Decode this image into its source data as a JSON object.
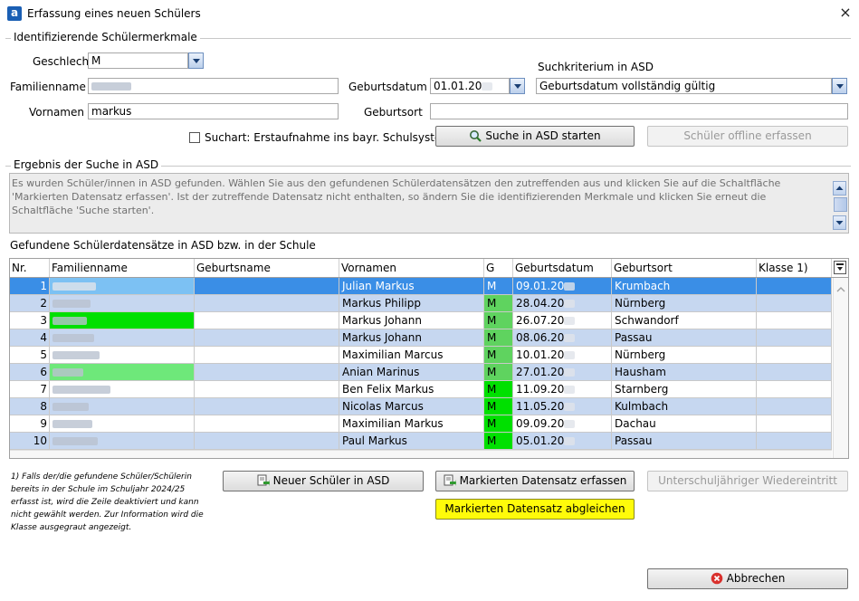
{
  "window": {
    "title": "Erfassung eines neuen Schülers",
    "close_label": "×",
    "app_icon_letter": "a"
  },
  "group1": {
    "label": "Identifizierende Schülermerkmale"
  },
  "form": {
    "geschlecht_label": "Geschlecht",
    "geschlecht_value": "M",
    "familienname_label": "Familienname",
    "familienname_value": "",
    "vornamen_label": "Vornamen",
    "vornamen_value": "markus",
    "geburtsdatum_label": "Geburtsdatum",
    "geburtsdatum_value": "01.01.20",
    "geburtsort_label": "Geburtsort",
    "geburtsort_value": "",
    "suchkriterium_label": "Suchkriterium in ASD",
    "suchkriterium_value": "Geburtsdatum vollständig gültig",
    "suchart_label": "Suchart: Erstaufnahme ins bayr. Schulsystem",
    "suchart_checked": false
  },
  "buttons": {
    "search": "Suche in ASD starten",
    "offline": "Schüler offline erfassen",
    "new_student": "Neuer Schüler in ASD",
    "capture_marked": "Markierten Datensatz erfassen",
    "reentry": "Unterschuljähriger Wiedereintritt",
    "compare_marked": "Markierten Datensatz abgleichen",
    "cancel": "Abbrechen"
  },
  "group2": {
    "label": "Ergebnis der Suche in ASD"
  },
  "info_text": "Es wurden Schüler/innen in ASD gefunden. Wählen Sie aus den gefundenen Schülerdatensätzen den zutreffenden aus und klicken Sie auf die Schaltfläche 'Markierten Datensatz erfassen'. Ist der zutreffende Datensatz nicht enthalten, so ändern Sie die identifizierenden Merkmale und klicken Sie erneut die Schaltfläche 'Suche starten'.",
  "grid_title": "Gefundene Schülerdatensätze in ASD bzw. in der Schule",
  "columns": [
    "Nr.",
    "Familienname",
    "Geburtsname",
    "Vornamen",
    "G",
    "Geburtsdatum",
    "Geburtsort",
    "Klasse 1)"
  ],
  "rows": [
    {
      "nr": "1",
      "vornamen": "Julian Markus",
      "g": "M",
      "geburtsdatum": "09.01.20",
      "geburtsort": "Krumbach",
      "selected": true
    },
    {
      "nr": "2",
      "vornamen": "Markus Philipp",
      "g": "M",
      "geburtsdatum": "28.04.20",
      "geburtsort": "Nürnberg"
    },
    {
      "nr": "3",
      "vornamen": "Markus Johann",
      "g": "M",
      "geburtsdatum": "26.07.20",
      "geburtsort": "Schwandorf"
    },
    {
      "nr": "4",
      "vornamen": "Markus Johann",
      "g": "M",
      "geburtsdatum": "08.06.20",
      "geburtsort": "Passau"
    },
    {
      "nr": "5",
      "vornamen": "Maximilian Marcus",
      "g": "M",
      "geburtsdatum": "10.01.20",
      "geburtsort": "Nürnberg"
    },
    {
      "nr": "6",
      "vornamen": "Anian Marinus",
      "g": "M",
      "geburtsdatum": "27.01.20",
      "geburtsort": "Hausham"
    },
    {
      "nr": "7",
      "vornamen": "Ben Felix Markus",
      "g": "M",
      "geburtsdatum": "11.09.20",
      "geburtsort": "Starnberg"
    },
    {
      "nr": "8",
      "vornamen": "Nicolas Marcus",
      "g": "M",
      "geburtsdatum": "11.05.20",
      "geburtsort": "Kulmbach"
    },
    {
      "nr": "9",
      "vornamen": "Maximilian Markus",
      "g": "M",
      "geburtsdatum": "09.09.20",
      "geburtsort": "Dachau"
    },
    {
      "nr": "10",
      "vornamen": "Paul Markus",
      "g": "M",
      "geburtsdatum": "05.01.20",
      "geburtsort": "Passau"
    }
  ],
  "footnote": "1) Falls der/die gefundene Schüler/Schülerin bereits in der Schule im Schuljahr 2024/25 erfasst ist, wird die Zeile deaktiviert und kann nicht gewählt werden. Zur Information wird die Klasse ausgegraut angezeigt.",
  "colors": {
    "selected_row": "#3a8ee6",
    "row_even": "#c6d7f0",
    "row_odd": "#ffffff",
    "match_green": "#00e000",
    "match_green_light": "#6ee87a",
    "yellow_button": "#fffb0a"
  }
}
